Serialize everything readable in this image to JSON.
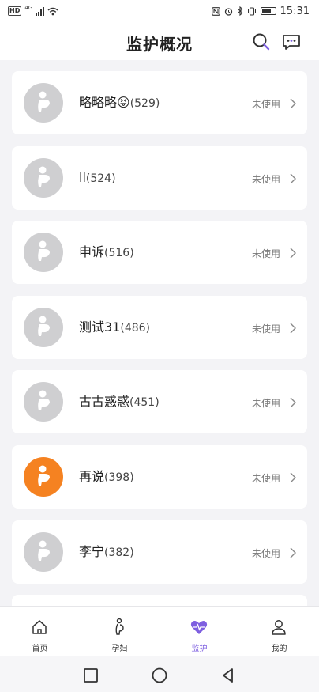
{
  "status_bar": {
    "hd": "HD",
    "net": "4G",
    "time": "15:31"
  },
  "header": {
    "title": "监护概况"
  },
  "list": [
    {
      "name": "略略略😝",
      "count": "(529)",
      "status": "未使用",
      "active": false
    },
    {
      "name": "ll",
      "count": "(524)",
      "status": "未使用",
      "active": false
    },
    {
      "name": "申诉",
      "count": "(516)",
      "status": "未使用",
      "active": false
    },
    {
      "name": "测试31",
      "count": "(486)",
      "status": "未使用",
      "active": false
    },
    {
      "name": "古古惑惑",
      "count": "(451)",
      "status": "未使用",
      "active": false
    },
    {
      "name": "再说",
      "count": "(398)",
      "status": "未使用",
      "active": true
    },
    {
      "name": "李宁",
      "count": "(382)",
      "status": "未使用",
      "active": false
    }
  ],
  "tabs": [
    {
      "label": "首页",
      "icon": "home-icon",
      "selected": false
    },
    {
      "label": "孕妇",
      "icon": "pregnant-woman-icon",
      "selected": false
    },
    {
      "label": "监护",
      "icon": "heart-monitor-icon",
      "selected": true
    },
    {
      "label": "我的",
      "icon": "person-icon",
      "selected": false
    }
  ],
  "colors": {
    "accent": "#7e5fe0",
    "avatar_active": "#f58221",
    "avatar_inactive": "#cfcfd1"
  }
}
